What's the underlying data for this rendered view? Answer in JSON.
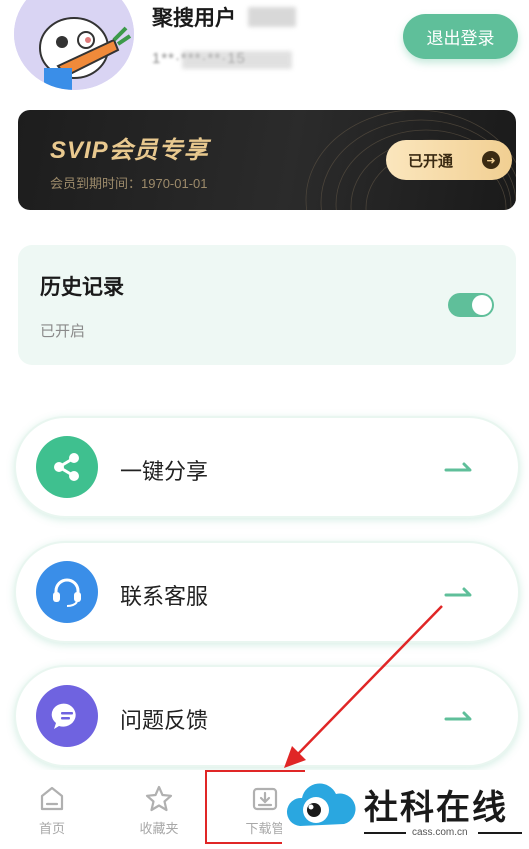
{
  "profile": {
    "username": "聚搜用户",
    "user_id": "1**·***·**·15",
    "logout_label": "退出登录"
  },
  "svip": {
    "title": "SVIP会员专享",
    "expire_text": "会员到期时间：1970-01-01",
    "button_label": "已开通"
  },
  "history": {
    "title": "历史记录",
    "status": "已开启",
    "enabled": true
  },
  "menu": {
    "items": [
      {
        "label": "一键分享",
        "icon": "share-icon",
        "color": "#3fc08f"
      },
      {
        "label": "联系客服",
        "icon": "headset-icon",
        "color": "#3a8ee8"
      },
      {
        "label": "问题反馈",
        "icon": "chat-icon",
        "color": "#6f63e0"
      }
    ]
  },
  "bottom_nav": {
    "items": [
      {
        "label": "首页",
        "icon": "home-icon"
      },
      {
        "label": "收藏夹",
        "icon": "star-icon"
      },
      {
        "label": "下载管",
        "icon": "download-icon"
      }
    ]
  },
  "watermark": {
    "name": "社科在线",
    "domain": "cass.com.cn"
  },
  "colors": {
    "accent": "#5fbf9a",
    "svip_gold": "#e9c98f",
    "annotation_red": "#e02626"
  }
}
